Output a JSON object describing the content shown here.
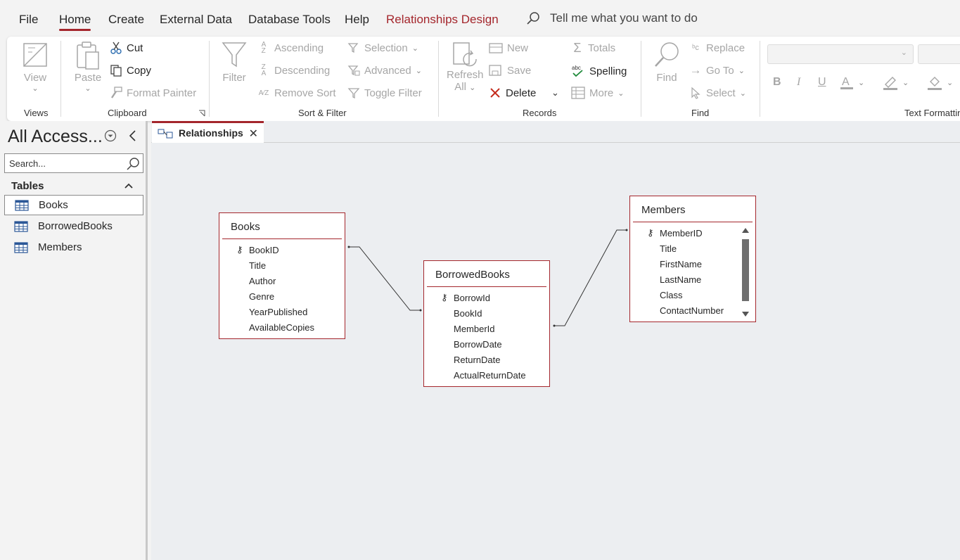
{
  "menu": {
    "items": [
      "File",
      "Home",
      "Create",
      "External Data",
      "Database Tools",
      "Help",
      "Relationships Design"
    ],
    "tell_me": "Tell me what you want to do"
  },
  "ribbon": {
    "views": {
      "view": "View",
      "label": "Views"
    },
    "clipboard": {
      "paste": "Paste",
      "cut": "Cut",
      "copy": "Copy",
      "format_painter": "Format Painter",
      "label": "Clipboard"
    },
    "sort_filter": {
      "filter": "Filter",
      "ascending": "Ascending",
      "descending": "Descending",
      "remove_sort": "Remove Sort",
      "selection": "Selection",
      "advanced": "Advanced",
      "toggle_filter": "Toggle Filter",
      "label": "Sort & Filter"
    },
    "records": {
      "refresh": "Refresh",
      "refresh_all": "All",
      "new": "New",
      "save": "Save",
      "delete": "Delete",
      "totals": "Totals",
      "spelling": "Spelling",
      "more": "More",
      "label": "Records"
    },
    "find": {
      "find": "Find",
      "replace": "Replace",
      "go_to": "Go To",
      "select": "Select",
      "label": "Find"
    },
    "text_formatting": {
      "bold": "B",
      "italic": "I",
      "underline": "U",
      "label": "Text Formatting"
    }
  },
  "nav": {
    "title": "All Access...",
    "search_placeholder": "Search...",
    "section": "Tables",
    "items": [
      "Books",
      "BorrowedBooks",
      "Members"
    ]
  },
  "tab": {
    "label": "Relationships"
  },
  "tables": {
    "books": {
      "title": "Books",
      "fields": [
        "BookID",
        "Title",
        "Author",
        "Genre",
        "YearPublished",
        "AvailableCopies"
      ]
    },
    "borrowed": {
      "title": "BorrowedBooks",
      "fields": [
        "BorrowId",
        "BookId",
        "MemberId",
        "BorrowDate",
        "ReturnDate",
        "ActualReturnDate"
      ]
    },
    "members": {
      "title": "Members",
      "fields": [
        "MemberID",
        "Title",
        "FirstName",
        "LastName",
        "Class",
        "ContactNumber"
      ]
    }
  },
  "colors": {
    "accent": "#a4262c",
    "disabled": "#a6a6a6",
    "delete": "#c42b1c",
    "spelling_check": "#1e8a3a"
  }
}
